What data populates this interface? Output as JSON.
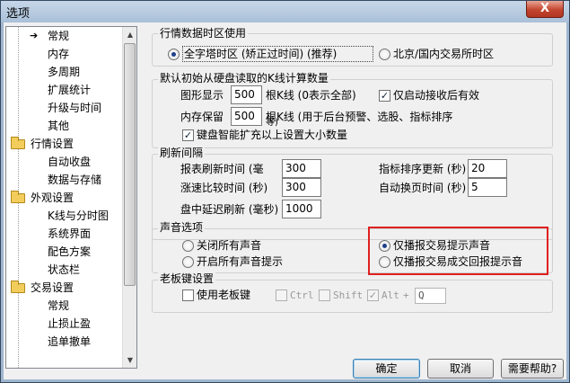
{
  "window": {
    "title": "选项",
    "close_glyph": "X"
  },
  "tree": {
    "items": [
      {
        "label": "常规",
        "selected": true,
        "arrow": "➔"
      },
      {
        "label": "内存"
      },
      {
        "label": "多周期"
      },
      {
        "label": "扩展统计"
      },
      {
        "label": "升级与时间"
      },
      {
        "label": "其他"
      },
      {
        "label": "行情设置",
        "folder": true
      },
      {
        "label": "自动收盘"
      },
      {
        "label": "数据与存储"
      },
      {
        "label": "外观设置",
        "folder": true
      },
      {
        "label": "K线与分时图"
      },
      {
        "label": "系统界面"
      },
      {
        "label": "配色方案"
      },
      {
        "label": "状态栏"
      },
      {
        "label": "交易设置",
        "folder": true
      },
      {
        "label": "常规"
      },
      {
        "label": "止损止盈"
      },
      {
        "label": "追单撤单"
      }
    ],
    "scroll_up": "▲",
    "scroll_down": "▼"
  },
  "timezone": {
    "title": "行情数据时区使用",
    "opt1": "全字塔时区 (矫正过时间) (推荐)",
    "opt2": "北京/国内交易所时区",
    "selected": 1
  },
  "initial_kline": {
    "title": "默认初始从硬盘读取的K线计算数量",
    "display_label": "图形显示",
    "display_value": "500",
    "display_suffix": "根K线  (0表示全部)",
    "only_after_start_label": "仅启动接收后有效",
    "only_after_start_checked": true,
    "memory_label": "内存保留",
    "memory_value": "500",
    "memory_suffix": "根K线  (用于后台预警、选股、指标排序",
    "memory_suffix_overflow": "等)",
    "smart_label": "键盘智能扩充以上设置大小数量",
    "smart_checked": true
  },
  "refresh": {
    "title": "刷新间隔",
    "report_label": "报表刷新时间 (毫",
    "report_value": "300",
    "sort_label": "指标排序更新 (秒)",
    "sort_value": "20",
    "speed_label": "涨速比较时间 (秒)",
    "speed_value": "300",
    "page_label": "自动换页时间 (秒)",
    "page_value": "5",
    "delay_label": "盘中延迟刷新 (毫秒)",
    "delay_value": "1000"
  },
  "sound": {
    "title": "声音选项",
    "opt_off": "关闭所有声音",
    "opt_on": "开启所有声音提示",
    "opt_trade": "仅播报交易提示声音",
    "opt_return": "仅播报交易成交回报提示音",
    "selected": "opt_trade"
  },
  "boss_key": {
    "title": "老板键设置",
    "use_label": "使用老板键",
    "use_checked": false,
    "ctrl_label": "Ctrl",
    "shift_label": "Shift",
    "alt_label": "Alt",
    "plus": "+",
    "key_value": "Q",
    "alt_checked": true
  },
  "buttons": {
    "ok": "确定",
    "cancel": "取消",
    "help": "需要帮助?"
  },
  "check_glyph": "✓"
}
